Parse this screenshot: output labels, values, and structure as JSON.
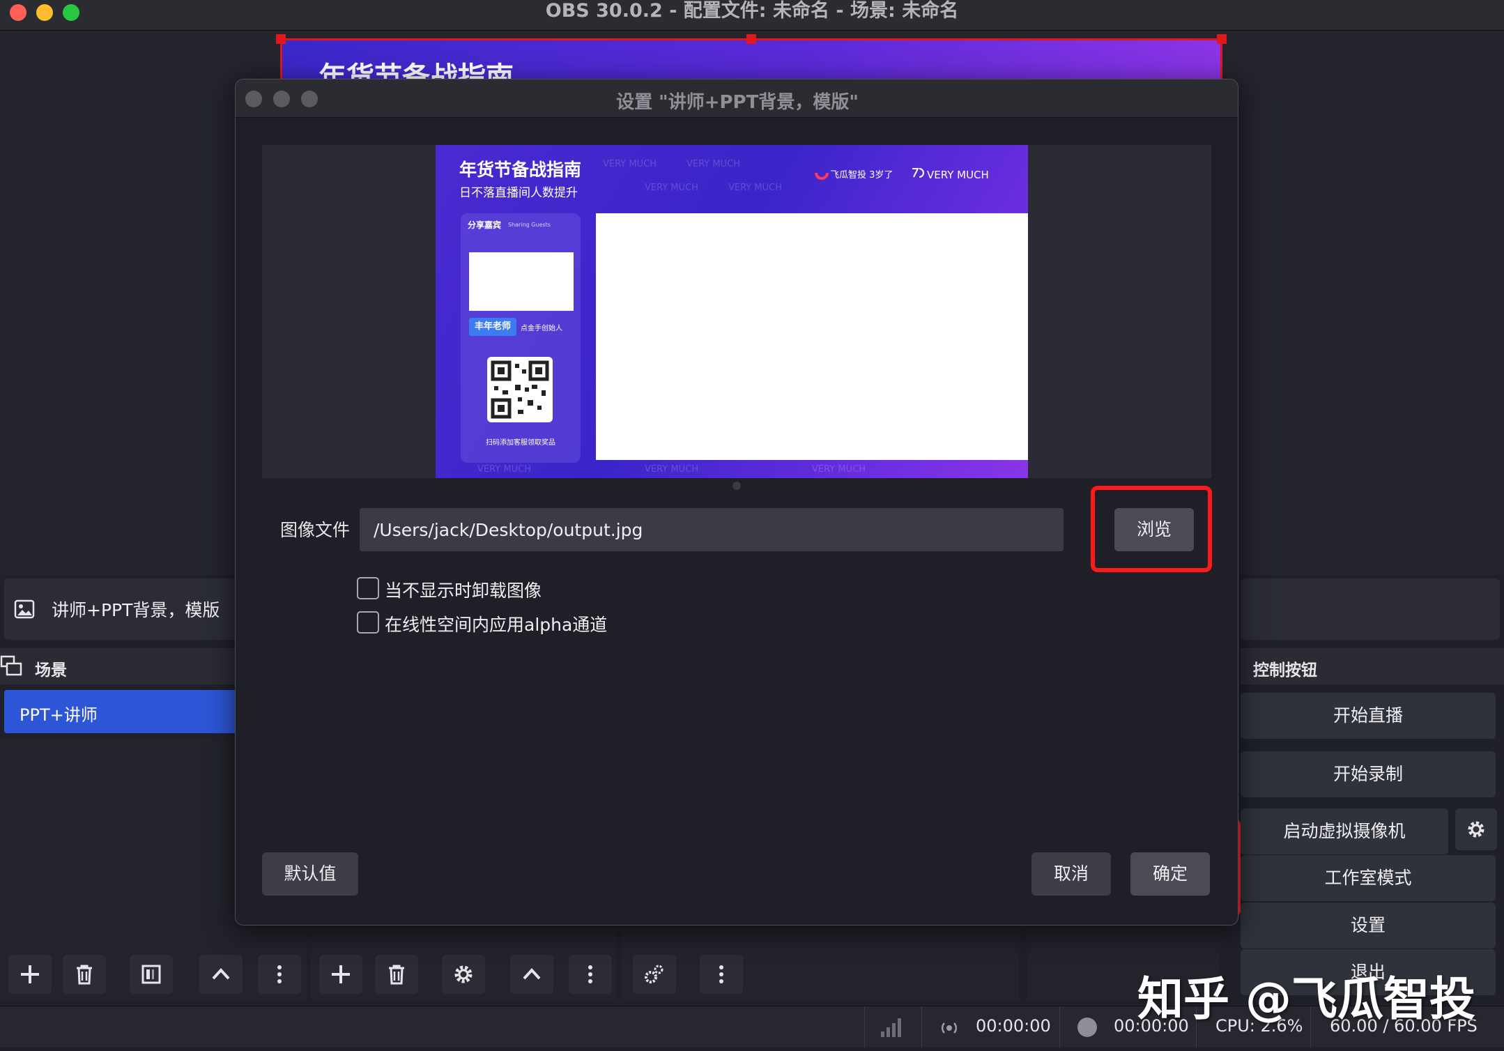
{
  "window": {
    "title": "OBS 30.0.2 - 配置文件: 未命名 - 场景: 未命名",
    "traffic_lights": [
      "#ff5f57",
      "#febc2e",
      "#28c840"
    ]
  },
  "preview": {
    "canvas_title": "年货节备战指南",
    "accent_color": "#e0181e"
  },
  "dialog": {
    "title": "设置 \"讲师+PPT背景，模版\"",
    "slide": {
      "title": "年货节备战指南",
      "subtitle": "日不落直播间人数提升",
      "logo_text": "飞瓜智投",
      "logo_badge": "3岁了",
      "vm_text": "VERY MUCH",
      "side_heading": "分享嘉宾",
      "side_heading_en": "Sharing Guests",
      "teacher": "丰年老师",
      "founder": "点金手创始人",
      "scan_text": "扫码添加客服领取奖品",
      "watermark": "VERY MUCH"
    },
    "image_file_label": "图像文件",
    "image_file_value": "/Users/jack/Desktop/output.jpg",
    "browse_label": "浏览",
    "checkboxes": [
      {
        "label": "当不显示时卸载图像",
        "checked": false
      },
      {
        "label": "在线性空间内应用alpha通道",
        "checked": false
      }
    ],
    "defaults_label": "默认值",
    "cancel_label": "取消",
    "ok_label": "确定",
    "highlight_color": "#ff1a1a"
  },
  "sources": {
    "item_label": "讲师+PPT背景，模版"
  },
  "scenes": {
    "title": "场景",
    "items": [
      "PPT+讲师"
    ]
  },
  "controls": {
    "title": "控制按钮",
    "start_stream": "开始直播",
    "start_record": "开始录制",
    "virtual_cam": "启动虚拟摄像机",
    "studio_mode": "工作室模式",
    "settings": "设置",
    "exit": "退出"
  },
  "status": {
    "stream_time": "00:00:00",
    "record_time": "00:00:00",
    "cpu": "CPU: 2.6%",
    "fps": "60.00 / 60.00 FPS"
  },
  "watermark": "知乎 @飞瓜智投"
}
